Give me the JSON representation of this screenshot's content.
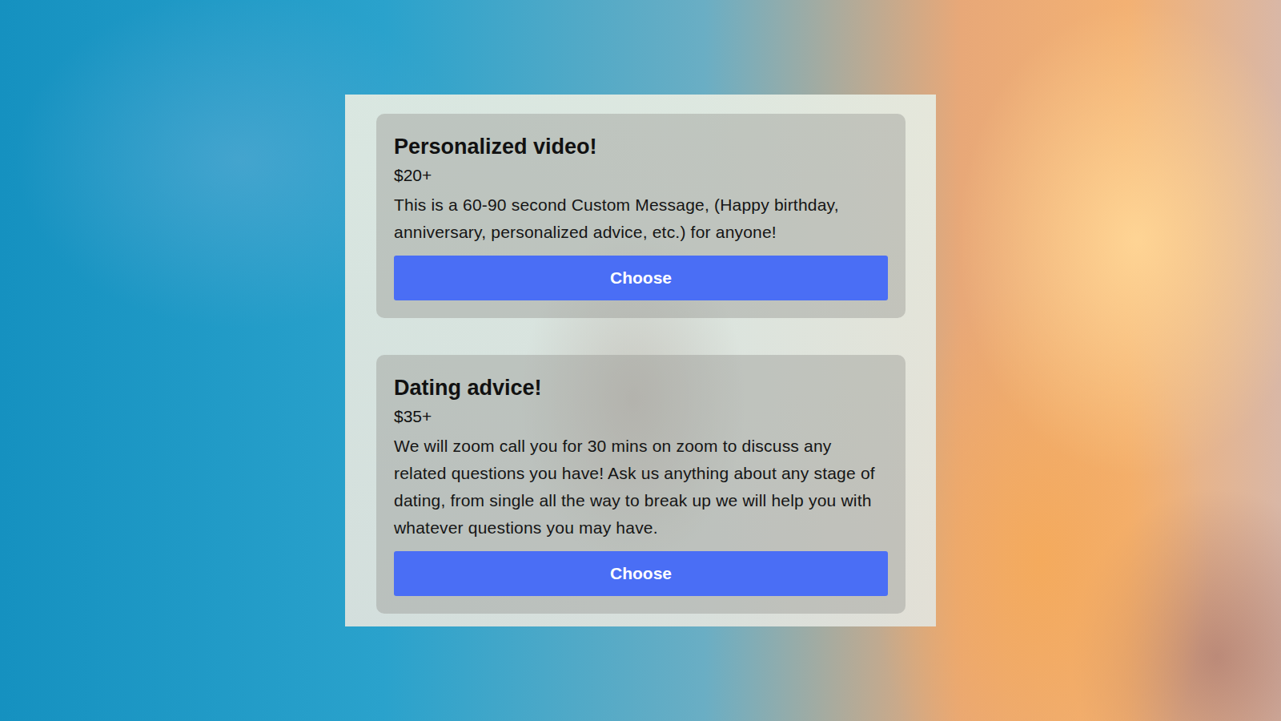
{
  "cards": [
    {
      "title": "Personalized video!",
      "price": "$20+",
      "description": "This is a 60-90 second Custom Message, (Happy birthday, anniversary, personalized advice, etc.) for anyone!",
      "button": "Choose"
    },
    {
      "title": "Dating advice!",
      "price": "$35+",
      "description": "We will zoom call you for 30 mins on zoom to discuss any related questions you have! Ask us anything about any stage of dating, from single all the way to break up we will help you with whatever questions you may have.",
      "button": "Choose"
    }
  ]
}
